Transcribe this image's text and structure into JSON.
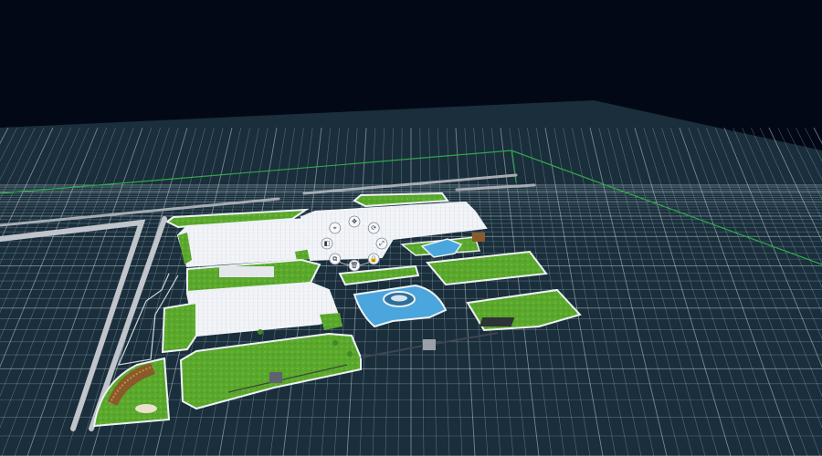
{
  "scene": {
    "background": "#030816",
    "grid_color": "#c9e3f2",
    "lawn_color": "#5aa82c",
    "paving_color": "#f3f5f8",
    "water_color": "#4aa6dc",
    "road_color": "#b9bec6",
    "site_boundary_color": "#2ea84a"
  },
  "gizmo": {
    "buttons": [
      {
        "name": "move-icon",
        "glyph": "✥"
      },
      {
        "name": "rotate-icon",
        "glyph": "⟳"
      },
      {
        "name": "scale-icon",
        "glyph": "⤢"
      },
      {
        "name": "lock-icon",
        "glyph": "🔒"
      },
      {
        "name": "delete-icon",
        "glyph": "🗑"
      },
      {
        "name": "copy-icon",
        "glyph": "⧉"
      },
      {
        "name": "layers-icon",
        "glyph": "◧"
      },
      {
        "name": "pin-icon",
        "glyph": "⌖"
      }
    ]
  }
}
